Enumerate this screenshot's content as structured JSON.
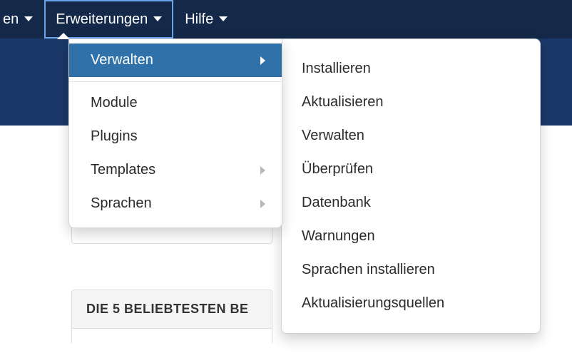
{
  "navbar": {
    "partial_left": "en",
    "extensions": "Erweiterungen",
    "help": "Hilfe"
  },
  "dropdown": {
    "manage": "Verwalten",
    "modules": "Module",
    "plugins": "Plugins",
    "templates": "Templates",
    "languages": "Sprachen"
  },
  "submenu": {
    "install": "Installieren",
    "update": "Aktualisieren",
    "manage": "Verwalten",
    "check": "Überprüfen",
    "database": "Datenbank",
    "warnings": "Warnungen",
    "install_languages": "Sprachen installieren",
    "update_sites": "Aktualisierungsquellen"
  },
  "panel": {
    "heading": "DIE 5 BELIEBTESTEN BE"
  }
}
